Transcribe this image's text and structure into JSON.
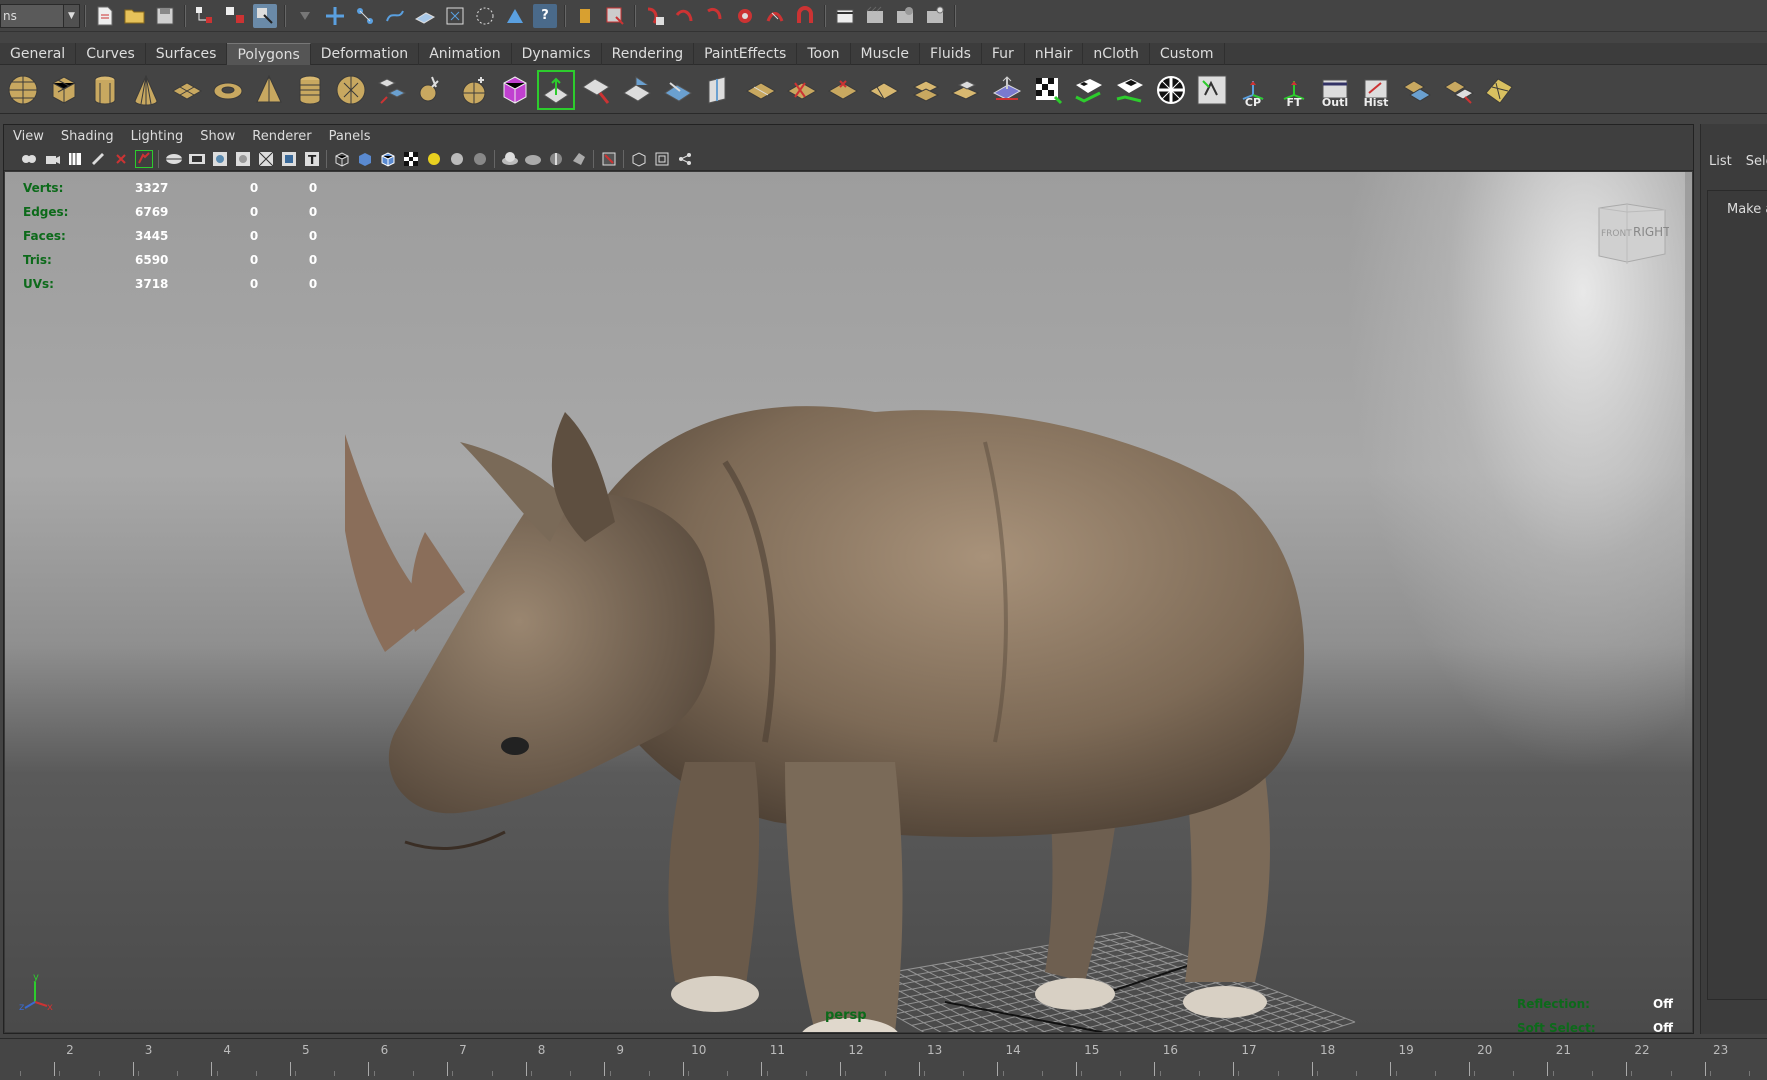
{
  "top_toolbar": {
    "mode_value": "ns",
    "icons": [
      "new-scene-icon",
      "open-scene-icon",
      "save-scene-icon",
      "select-hierarchy-icon",
      "select-object-icon",
      "select-component-icon",
      "lock-selection-icon",
      "snap-grid-icon",
      "snap-curve-icon",
      "snap-point-icon",
      "snap-view-plane-icon",
      "snap-live-icon",
      "history-icon",
      "construction-icon",
      "help-icon",
      "input-ops-icon",
      "output-ops-icon",
      "render-current-icon",
      "ipr-render-icon",
      "render-settings-icon",
      "hypershade-icon",
      "render-view-icon",
      "magnet-icon",
      "clapboard-icon",
      "render-sequence-icon",
      "render-globals-icon",
      "render-toggle-icon"
    ]
  },
  "shelf_tabs": [
    "General",
    "Curves",
    "Surfaces",
    "Polygons",
    "Deformation",
    "Animation",
    "Dynamics",
    "Rendering",
    "PaintEffects",
    "Toon",
    "Muscle",
    "Fluids",
    "Fur",
    "nHair",
    "nCloth",
    "Custom"
  ],
  "shelf_active": "Polygons",
  "shelf_labels": {
    "cp": "CP",
    "ft": "FT",
    "outl": "Outl",
    "hist": "Hist"
  },
  "panel_menu": [
    "View",
    "Shading",
    "Lighting",
    "Show",
    "Renderer",
    "Panels"
  ],
  "hud": [
    {
      "label": "Verts:",
      "v1": "3327",
      "v2": "0",
      "v3": "0"
    },
    {
      "label": "Edges:",
      "v1": "6769",
      "v2": "0",
      "v3": "0"
    },
    {
      "label": "Faces:",
      "v1": "3445",
      "v2": "0",
      "v3": "0"
    },
    {
      "label": "Tris:",
      "v1": "6590",
      "v2": "0",
      "v3": "0"
    },
    {
      "label": "UVs:",
      "v1": "3718",
      "v2": "0",
      "v3": "0"
    }
  ],
  "view_cube": {
    "front": "FRONT",
    "right": "RIGHT"
  },
  "camera_label": "persp",
  "status": [
    {
      "label": "Reflection:",
      "value": "Off"
    },
    {
      "label": "Soft Select:",
      "value": "Off"
    }
  ],
  "axis": {
    "y": "y",
    "z": "z",
    "x": "x"
  },
  "right_panel": {
    "tab1": "List",
    "tab2": "Sele",
    "make_text": "Make a"
  },
  "timeline": {
    "labels": [
      "2",
      "3",
      "4",
      "5",
      "6",
      "7",
      "8",
      "9",
      "10",
      "11",
      "12",
      "13",
      "14",
      "15",
      "16",
      "17",
      "18",
      "19",
      "20",
      "21",
      "22",
      "23"
    ]
  },
  "colors": {
    "hud_label": "#0c6a1a",
    "accent_active_tab": "#555555"
  }
}
